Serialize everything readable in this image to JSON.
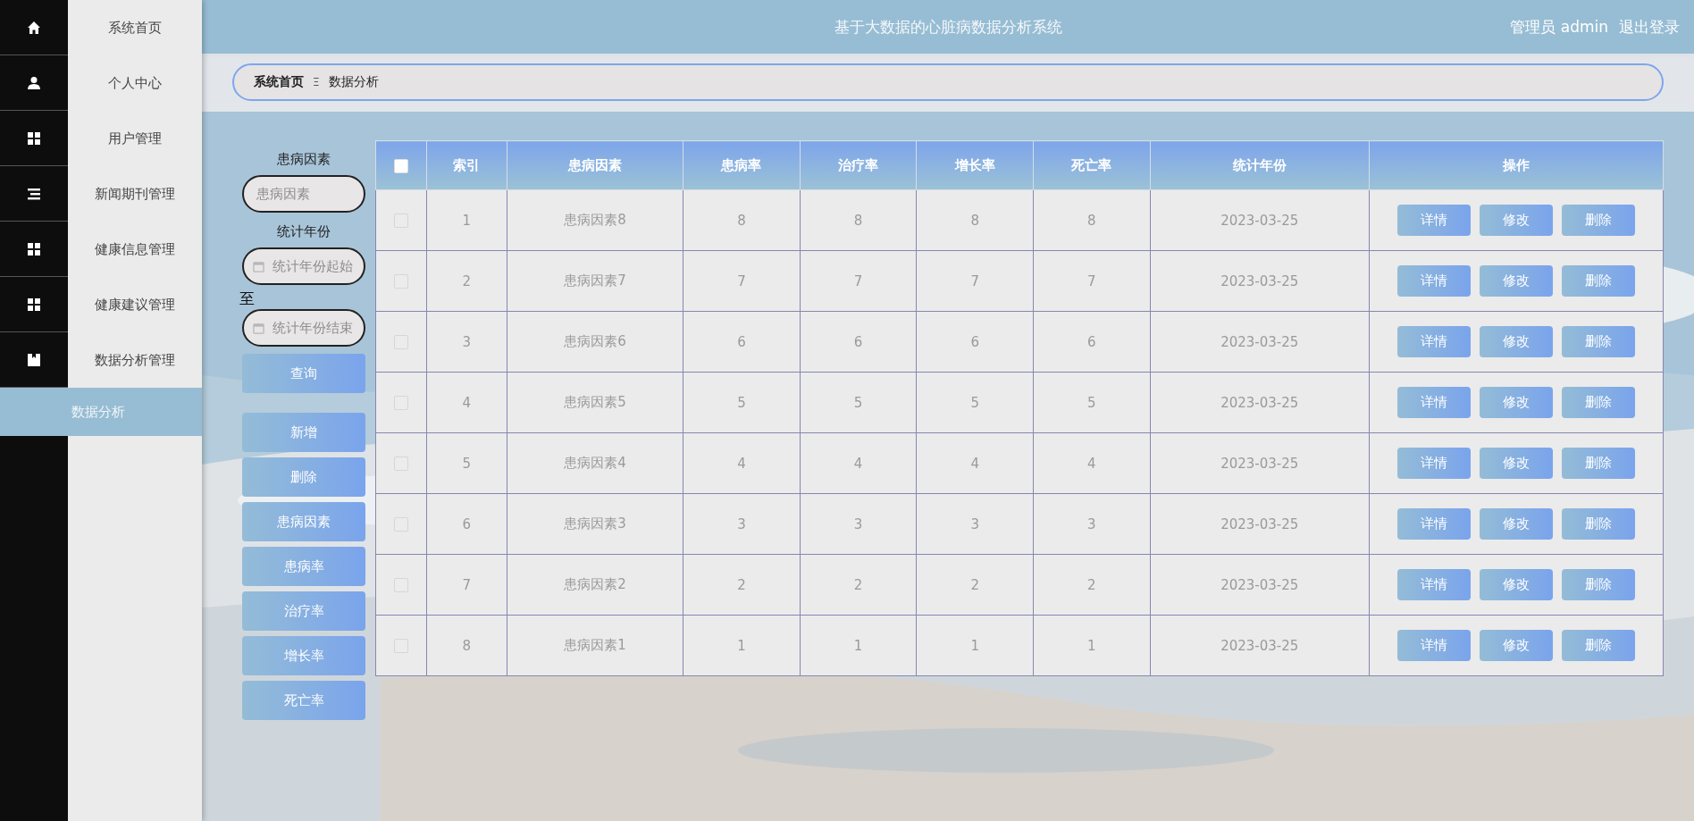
{
  "sidebar": {
    "items": [
      {
        "label": "系统首页",
        "selected": false
      },
      {
        "label": "个人中心",
        "selected": false
      },
      {
        "label": "用户管理",
        "selected": false
      },
      {
        "label": "新闻期刊管理",
        "selected": false
      },
      {
        "label": "健康信息管理",
        "selected": false
      },
      {
        "label": "健康建议管理",
        "selected": false
      },
      {
        "label": "数据分析管理",
        "selected": false,
        "expanded": true,
        "children": [
          {
            "label": "数据分析",
            "selected": true
          }
        ]
      }
    ]
  },
  "header": {
    "title": "基于大数据的心脏病数据分析系统",
    "user": "管理员 admin",
    "logout": "退出登录"
  },
  "breadcrumb": {
    "home": "系统首页",
    "separator": "Ξ",
    "current": "数据分析"
  },
  "filters": {
    "factor_label": "患病因素",
    "factor_placeholder": "患病因素",
    "year_label": "统计年份",
    "year_start_placeholder": "统计年份起始",
    "to": "至",
    "year_end_placeholder": "统计年份结束",
    "search": "查询"
  },
  "actions": [
    "新增",
    "删除",
    "患病因素",
    "患病率",
    "治疗率",
    "增长率",
    "死亡率"
  ],
  "table": {
    "header_checked": false,
    "columns": [
      "索引",
      "患病因素",
      "患病率",
      "治疗率",
      "增长率",
      "死亡率",
      "统计年份",
      "操作"
    ],
    "rows": [
      {
        "checked": false,
        "cells": [
          "1",
          "患病因素8",
          "8",
          "8",
          "8",
          "8",
          "2023-03-25"
        ],
        "buttons": [
          "详情",
          "修改",
          "删除"
        ]
      },
      {
        "checked": false,
        "cells": [
          "2",
          "患病因素7",
          "7",
          "7",
          "7",
          "7",
          "2023-03-25"
        ],
        "buttons": [
          "详情",
          "修改",
          "删除"
        ]
      },
      {
        "checked": false,
        "cells": [
          "3",
          "患病因素6",
          "6",
          "6",
          "6",
          "6",
          "2023-03-25"
        ],
        "buttons": [
          "详情",
          "修改",
          "删除"
        ]
      },
      {
        "checked": false,
        "cells": [
          "4",
          "患病因素5",
          "5",
          "5",
          "5",
          "5",
          "2023-03-25"
        ],
        "buttons": [
          "详情",
          "修改",
          "删除"
        ]
      },
      {
        "checked": false,
        "cells": [
          "5",
          "患病因素4",
          "4",
          "4",
          "4",
          "4",
          "2023-03-25"
        ],
        "buttons": [
          "详情",
          "修改",
          "删除"
        ]
      },
      {
        "checked": false,
        "cells": [
          "6",
          "患病因素3",
          "3",
          "3",
          "3",
          "3",
          "2023-03-25"
        ],
        "buttons": [
          "详情",
          "修改",
          "删除"
        ]
      },
      {
        "checked": false,
        "cells": [
          "7",
          "患病因素2",
          "2",
          "2",
          "2",
          "2",
          "2023-03-25"
        ],
        "buttons": [
          "详情",
          "修改",
          "删除"
        ]
      },
      {
        "checked": false,
        "cells": [
          "8",
          "患病因素1",
          "1",
          "1",
          "1",
          "1",
          "2023-03-25"
        ],
        "buttons": [
          "详情",
          "修改",
          "删除"
        ]
      }
    ]
  }
}
